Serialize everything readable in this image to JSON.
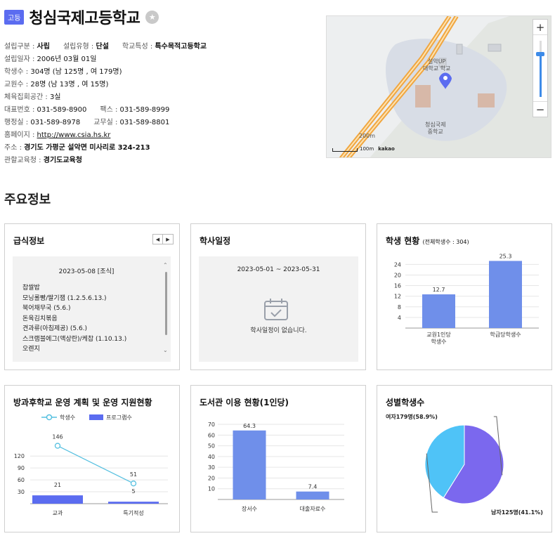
{
  "header": {
    "badge": "고등",
    "school_name": "청심국제고등학교",
    "favorite_icon": "star-icon"
  },
  "info": {
    "est_type_label": "설립구분 :",
    "est_type": "사립",
    "est_kind_label": "설립유형 :",
    "est_kind": "단설",
    "feature_label": "학교특성 :",
    "feature": "특수목적고등학교",
    "est_date_label": "설립일자 :",
    "est_date": "2006년 03월 01일",
    "students_label": "학생수 :",
    "students": "304명 (남 125명 , 여 179명)",
    "teachers_label": "교원수 :",
    "teachers": "28명 (남 13명 , 여 15명)",
    "gym_label": "체육집회공간 :",
    "gym": "3실",
    "phone_label": "대표번호 :",
    "phone": "031-589-8900",
    "fax_label": "팩스 :",
    "fax": "031-589-8999",
    "admin_label": "행정실 :",
    "admin": "031-589-8978",
    "staff_label": "교무실 :",
    "staff": "031-589-8801",
    "homepage_label": "홈페이지 :",
    "homepage": "http://www.csia.hs.kr",
    "address_label": "주소 :",
    "address": "경기도 가평군 설악면 미사리로 324-213",
    "office_label": "관할교육청 :",
    "office": "경기도교육청"
  },
  "map": {
    "road_label": "",
    "place1": "설악UP\n대학교 학교",
    "place2": "청심국제\n중학교",
    "elev": "200m",
    "scale": "100m",
    "brand": "kakao",
    "zoom_in": "+",
    "zoom_out": "−"
  },
  "section_title": "주요정보",
  "meal": {
    "title": "급식정보",
    "prev": "◀",
    "next": "▶",
    "date": "2023-05-08 [조식]",
    "items": [
      "찹쌀밥",
      "모닝롤빵/딸기잼 (1.2.5.6.13.)",
      "북어채무국 (5.6.)",
      "돈육김치볶음",
      "견과류(아침제공) (5.6.)",
      "스크램블에그(액상란)/케찹 (1.10.13.)",
      "오렌지"
    ]
  },
  "schedule": {
    "title": "학사일정",
    "range": "2023-05-01 ~ 2023-05-31",
    "empty": "학사일정이 없습니다."
  },
  "student_status": {
    "title": "학생 현황",
    "subtitle": "(전체학생수 : 304)"
  },
  "afterschool": {
    "title": "방과후학교 운영 계획 및 운영 지원현황"
  },
  "library": {
    "title": "도서관 이용 현황(1인당)"
  },
  "gender": {
    "title": "성별학생수"
  },
  "colors": {
    "accent": "#5b6cf0",
    "bar": "#6f8fea",
    "line": "#55c0e0",
    "pie_female": "#7b68ee",
    "pie_male": "#4fc3f7"
  },
  "chart_data": [
    {
      "type": "bar",
      "title": "학생 현황",
      "categories": [
        "교원1인당\n학생수",
        "학급당학생수"
      ],
      "values": [
        12.7,
        25.3
      ],
      "yticks": [
        4,
        8,
        12,
        16,
        20,
        24
      ],
      "ylim": [
        0,
        27
      ],
      "grid": true
    },
    {
      "type": "bar",
      "title": "방과후학교 운영 계획 및 운영 지원현황",
      "categories": [
        "교과",
        "특기적성"
      ],
      "series": [
        {
          "name": "학생수",
          "type": "line",
          "values": [
            146,
            51
          ]
        },
        {
          "name": "프로그램수",
          "type": "bar",
          "values": [
            21,
            5
          ]
        }
      ],
      "yticks": [
        30,
        60,
        90,
        120
      ],
      "ylim": [
        0,
        170
      ],
      "legend": "top",
      "grid": true
    },
    {
      "type": "bar",
      "title": "도서관 이용 현황(1인당)",
      "categories": [
        "장서수",
        "대출자료수"
      ],
      "values": [
        64.3,
        7.4
      ],
      "yticks": [
        10,
        20,
        30,
        40,
        50,
        60,
        70
      ],
      "ylim": [
        0,
        72
      ],
      "grid": true
    },
    {
      "type": "pie",
      "title": "성별학생수",
      "slices": [
        {
          "label": "여자179명(58.9%)",
          "value": 179
        },
        {
          "label": "남자125명(41.1%)",
          "value": 125
        }
      ]
    }
  ]
}
